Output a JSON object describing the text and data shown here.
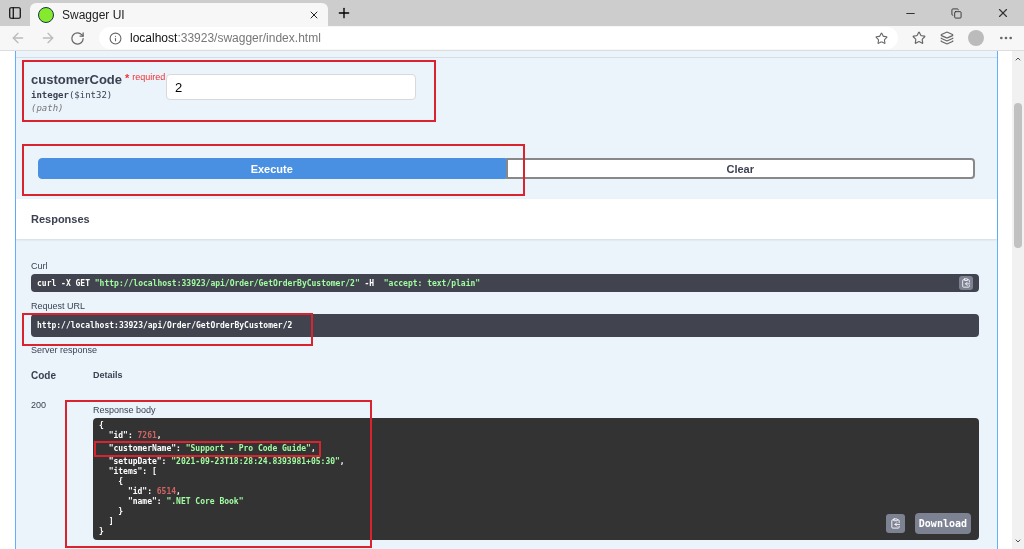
{
  "browser": {
    "tab_title": "Swagger UI",
    "url_host": "localhost",
    "url_rest": ":33923/swagger/index.html"
  },
  "parameter": {
    "name": "customerCode",
    "required_mark": "*",
    "required_label": "required",
    "type": "integer",
    "format": "($int32)",
    "location": "(path)",
    "value": "2"
  },
  "buttons": [
    {
      "label": "Execute",
      "kind": "primary"
    },
    {
      "label": "Clear",
      "kind": "secondary"
    }
  ],
  "responses": {
    "heading": "Responses",
    "curl_label": "Curl",
    "curl": [
      {
        "kind": "plain",
        "text": "curl -X GET "
      },
      {
        "kind": "string",
        "text": "\"http://localhost:33923/api/Order/GetOrderByCustomer/2\""
      },
      {
        "kind": "plain",
        "text": " -H  "
      },
      {
        "kind": "string",
        "text": "\"accept: text/plain\""
      }
    ],
    "request_url_label": "Request URL",
    "request_url": "http://localhost:33923/api/Order/GetOrderByCustomer/2",
    "server_response_label": "Server response",
    "columns": [
      "Code",
      "Details"
    ],
    "code": "200",
    "body_label": "Response body",
    "body": [
      {
        "highlighted": false,
        "tokens": [
          {
            "kind": "punct",
            "text": "{"
          }
        ]
      },
      {
        "highlighted": false,
        "tokens": [
          {
            "kind": "key",
            "text": "  \"id\": "
          },
          {
            "kind": "number",
            "text": "7261"
          },
          {
            "kind": "punct",
            "text": ","
          }
        ]
      },
      {
        "highlighted": true,
        "tokens": [
          {
            "kind": "key",
            "text": "  \"customerName\": "
          },
          {
            "kind": "string",
            "text": "\"Support - Pro Code Guide\""
          },
          {
            "kind": "punct",
            "text": ","
          }
        ]
      },
      {
        "highlighted": false,
        "tokens": [
          {
            "kind": "key",
            "text": "  \"setupDate\": "
          },
          {
            "kind": "string",
            "text": "\"2021-09-23T18:28:24.8393981+05:30\""
          },
          {
            "kind": "punct",
            "text": ","
          }
        ]
      },
      {
        "highlighted": false,
        "tokens": [
          {
            "kind": "key",
            "text": "  \"items\": ["
          }
        ]
      },
      {
        "highlighted": false,
        "tokens": [
          {
            "kind": "punct",
            "text": "    {"
          }
        ]
      },
      {
        "highlighted": false,
        "tokens": [
          {
            "kind": "key",
            "text": "      \"id\": "
          },
          {
            "kind": "number",
            "text": "6514"
          },
          {
            "kind": "punct",
            "text": ","
          }
        ]
      },
      {
        "highlighted": false,
        "tokens": [
          {
            "kind": "key",
            "text": "      \"name\": "
          },
          {
            "kind": "string",
            "text": "\".NET Core Book\""
          }
        ]
      },
      {
        "highlighted": false,
        "tokens": [
          {
            "kind": "punct",
            "text": "    }"
          }
        ]
      },
      {
        "highlighted": false,
        "tokens": [
          {
            "kind": "punct",
            "text": "  ]"
          }
        ]
      },
      {
        "highlighted": false,
        "tokens": [
          {
            "kind": "punct",
            "text": "}"
          }
        ]
      }
    ],
    "download": "Download"
  }
}
